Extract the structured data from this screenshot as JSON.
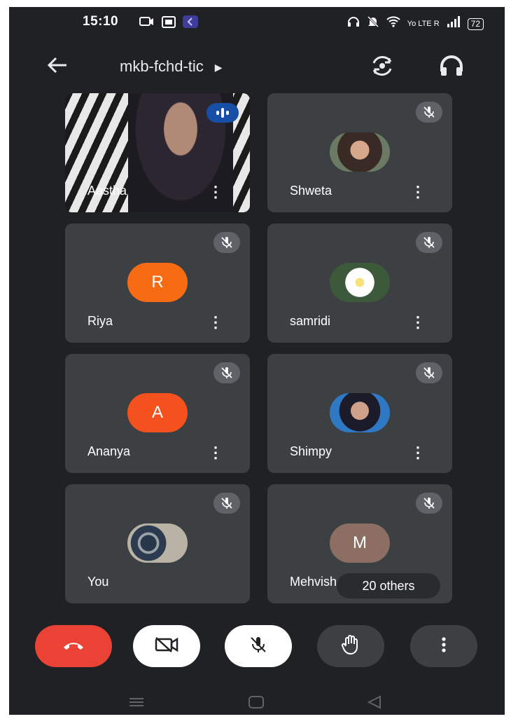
{
  "status_bar": {
    "time": "15:10",
    "right_text": "Yo LTE R",
    "battery": "72"
  },
  "appbar": {
    "meeting_code": "mkb-fchd-tic",
    "icons": [
      "back-arrow-icon",
      "switch-camera-icon",
      "headphones-icon"
    ]
  },
  "participants": [
    {
      "name": "Aastha",
      "type": "video",
      "speaking": true
    },
    {
      "name": "Shweta",
      "type": "photo",
      "muted": true
    },
    {
      "name": "Riya",
      "type": "initial",
      "initial": "R",
      "color": "#f76c12",
      "muted": true
    },
    {
      "name": "samridi",
      "type": "photo",
      "muted": true
    },
    {
      "name": "Ananya",
      "type": "initial",
      "initial": "A",
      "color": "#f4511e",
      "muted": true
    },
    {
      "name": "Shimpy",
      "type": "photo",
      "muted": true
    },
    {
      "name": "You",
      "type": "photo",
      "muted": true
    },
    {
      "name": "Mehvish",
      "type": "initial",
      "initial": "M",
      "color": "#8d6e63",
      "muted": true
    }
  ],
  "others_chip": "20 others",
  "controls": {
    "end_call_color": "#ea4335",
    "icons": [
      "end-call-icon",
      "camera-off-icon",
      "mic-off-icon",
      "raise-hand-icon",
      "more-vert-icon"
    ]
  }
}
